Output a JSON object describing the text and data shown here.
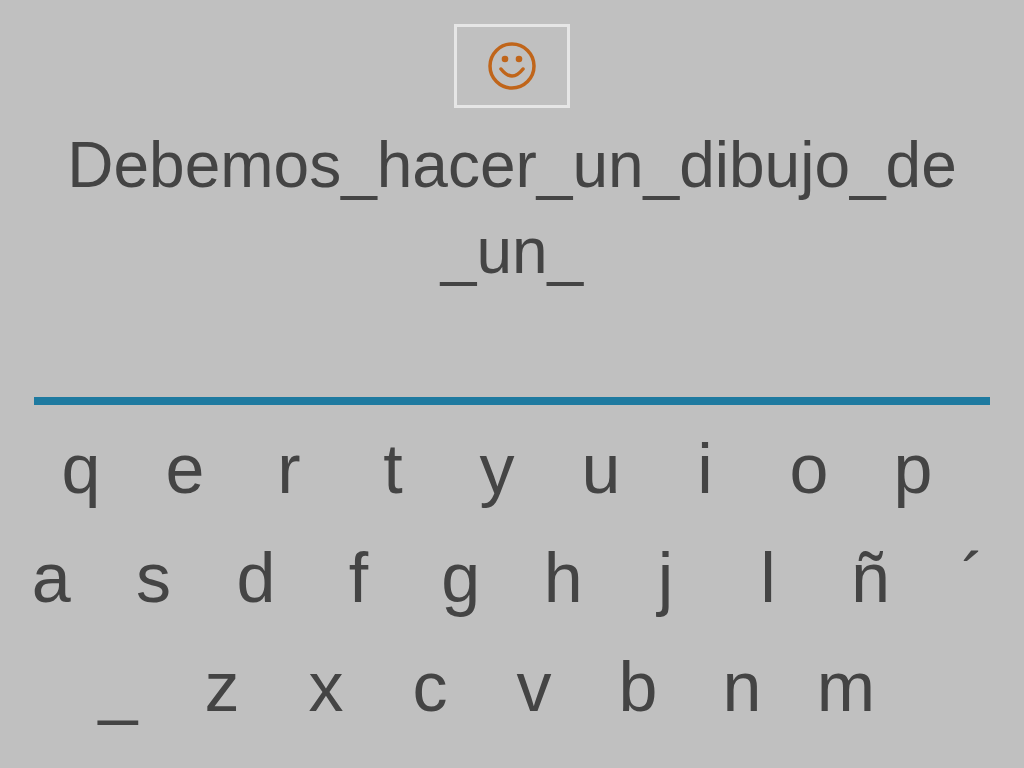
{
  "phrase_lines": [
    "Debemos_hacer_un_dibujo_de",
    "_un_"
  ],
  "keyboard_rows": [
    [
      "q",
      "e",
      "r",
      "t",
      "y",
      "u",
      "i",
      "o",
      "p"
    ],
    [
      "a",
      "s",
      "d",
      "f",
      "g",
      "h",
      "j",
      "l",
      "ñ",
      "´"
    ],
    [
      "_",
      "z",
      "x",
      "c",
      "v",
      "b",
      "n",
      "m"
    ]
  ]
}
